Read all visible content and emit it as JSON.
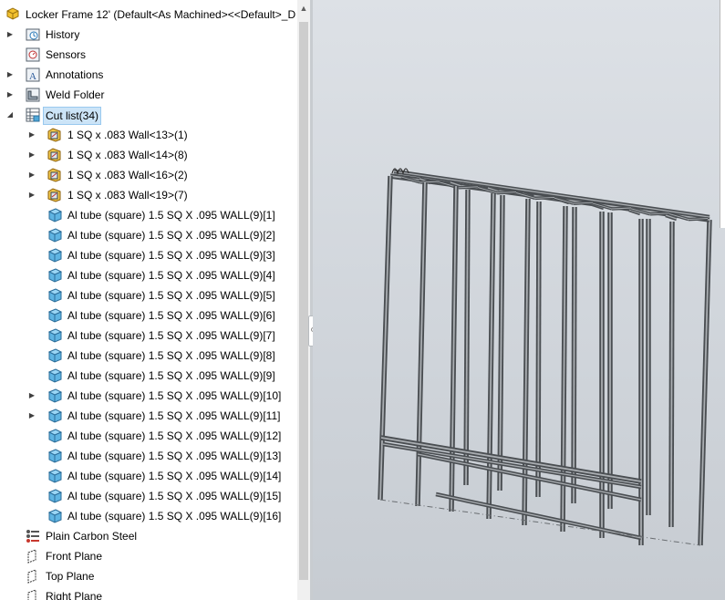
{
  "root": {
    "label": "Locker Frame 12'  (Default<As Machined><<Default>_D"
  },
  "tree": [
    {
      "label": "History",
      "icon": "history-icon",
      "indent": 26,
      "arrow": "right"
    },
    {
      "label": "Sensors",
      "icon": "sensors-icon",
      "indent": 26,
      "arrow": ""
    },
    {
      "label": "Annotations",
      "icon": "annotations-icon",
      "indent": 26,
      "arrow": "right"
    },
    {
      "label": "Weld Folder",
      "icon": "weld-folder-icon",
      "indent": 26,
      "arrow": "right"
    },
    {
      "label": "Cut list(34)",
      "icon": "cut-list-icon",
      "indent": 26,
      "arrow": "down",
      "selected": true
    },
    {
      "label": "1 SQ x .083 Wall<13>(1)",
      "icon": "weldment-body-icon",
      "indent": 50,
      "arrow": "right"
    },
    {
      "label": "1 SQ x .083 Wall<14>(8)",
      "icon": "weldment-body-icon",
      "indent": 50,
      "arrow": "right"
    },
    {
      "label": "1 SQ x .083 Wall<16>(2)",
      "icon": "weldment-body-icon",
      "indent": 50,
      "arrow": "right"
    },
    {
      "label": "1 SQ x .083 Wall<19>(7)",
      "icon": "weldment-body-icon",
      "indent": 50,
      "arrow": "right"
    },
    {
      "label": "Al tube (square) 1.5 SQ X .095 WALL(9)[1]",
      "icon": "solid-body-icon",
      "indent": 50,
      "arrow": ""
    },
    {
      "label": "Al tube (square) 1.5 SQ X .095 WALL(9)[2]",
      "icon": "solid-body-icon",
      "indent": 50,
      "arrow": ""
    },
    {
      "label": "Al tube (square) 1.5 SQ X .095 WALL(9)[3]",
      "icon": "solid-body-icon",
      "indent": 50,
      "arrow": ""
    },
    {
      "label": "Al tube (square) 1.5 SQ X .095 WALL(9)[4]",
      "icon": "solid-body-icon",
      "indent": 50,
      "arrow": ""
    },
    {
      "label": "Al tube (square) 1.5 SQ X .095 WALL(9)[5]",
      "icon": "solid-body-icon",
      "indent": 50,
      "arrow": ""
    },
    {
      "label": "Al tube (square) 1.5 SQ X .095 WALL(9)[6]",
      "icon": "solid-body-icon",
      "indent": 50,
      "arrow": ""
    },
    {
      "label": "Al tube (square) 1.5 SQ X .095 WALL(9)[7]",
      "icon": "solid-body-icon",
      "indent": 50,
      "arrow": ""
    },
    {
      "label": "Al tube (square) 1.5 SQ X .095 WALL(9)[8]",
      "icon": "solid-body-icon",
      "indent": 50,
      "arrow": ""
    },
    {
      "label": "Al tube (square) 1.5 SQ X .095 WALL(9)[9]",
      "icon": "solid-body-icon",
      "indent": 50,
      "arrow": ""
    },
    {
      "label": "Al tube (square) 1.5 SQ X .095 WALL(9)[10]",
      "icon": "solid-body-icon",
      "indent": 50,
      "arrow": "right"
    },
    {
      "label": "Al tube (square) 1.5 SQ X .095 WALL(9)[11]",
      "icon": "solid-body-icon",
      "indent": 50,
      "arrow": "right"
    },
    {
      "label": "Al tube (square) 1.5 SQ X .095 WALL(9)[12]",
      "icon": "solid-body-icon",
      "indent": 50,
      "arrow": ""
    },
    {
      "label": "Al tube (square) 1.5 SQ X .095 WALL(9)[13]",
      "icon": "solid-body-icon",
      "indent": 50,
      "arrow": ""
    },
    {
      "label": "Al tube (square) 1.5 SQ X .095 WALL(9)[14]",
      "icon": "solid-body-icon",
      "indent": 50,
      "arrow": ""
    },
    {
      "label": "Al tube (square) 1.5 SQ X .095 WALL(9)[15]",
      "icon": "solid-body-icon",
      "indent": 50,
      "arrow": ""
    },
    {
      "label": "Al tube (square) 1.5 SQ X .095 WALL(9)[16]",
      "icon": "solid-body-icon",
      "indent": 50,
      "arrow": ""
    },
    {
      "label": "Plain Carbon Steel",
      "icon": "material-icon",
      "indent": 26,
      "arrow": ""
    },
    {
      "label": "Front Plane",
      "icon": "plane-icon",
      "indent": 26,
      "arrow": ""
    },
    {
      "label": "Top Plane",
      "icon": "plane-icon",
      "indent": 26,
      "arrow": ""
    },
    {
      "label": "Right Plane",
      "icon": "plane-icon",
      "indent": 26,
      "arrow": ""
    }
  ],
  "colors": {
    "selection": "#cce4f7",
    "tube": "#7a7e82",
    "viewport_bg": "#d3d8de"
  }
}
